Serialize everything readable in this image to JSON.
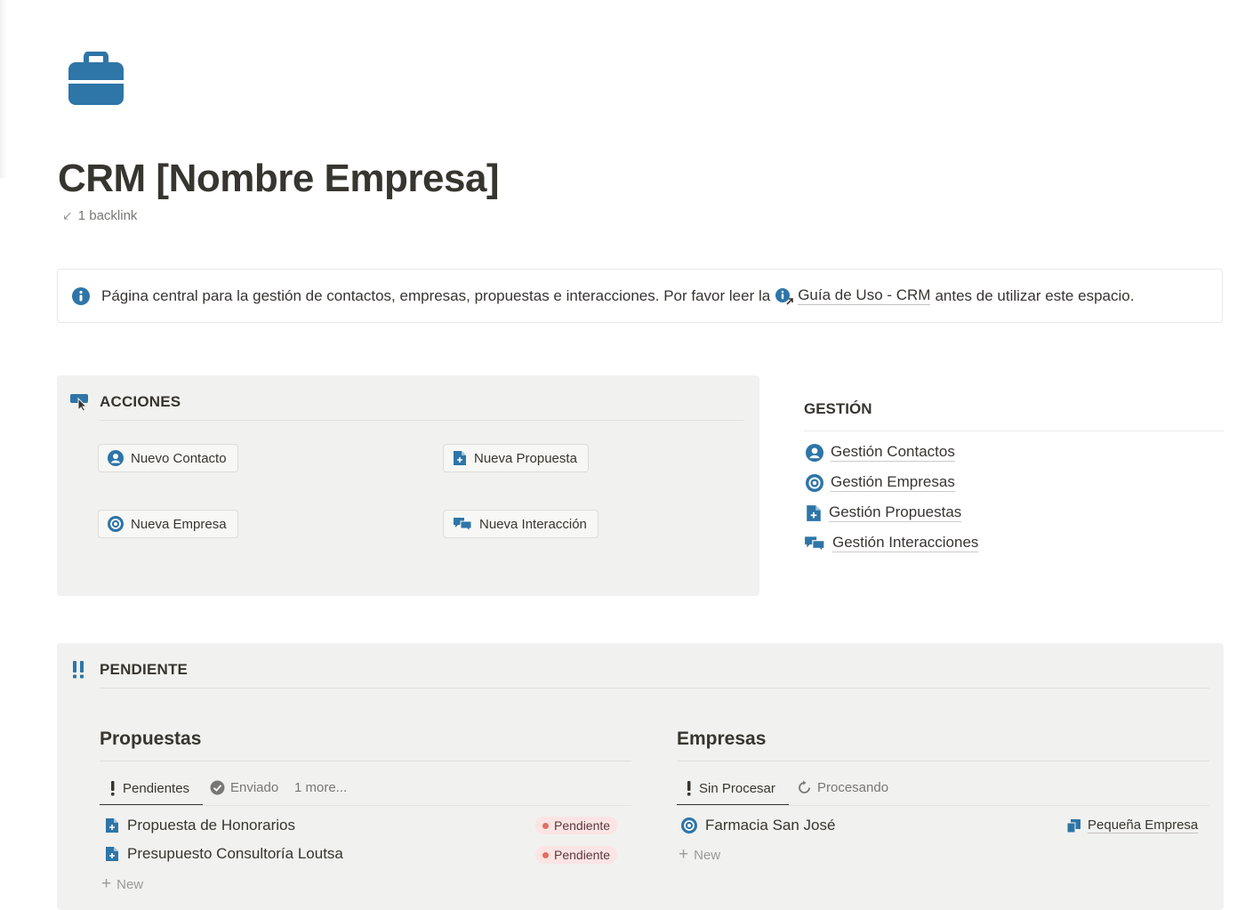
{
  "page": {
    "icon": "briefcase-icon",
    "title": "CRM [Nombre Empresa]",
    "backlink_text": "1 backlink"
  },
  "callout": {
    "icon": "info-icon",
    "text_before": "Página central para la gestión de contactos, empresas, propuestas e interacciones. Por favor leer la",
    "link_icon": "info-link-icon",
    "link_text": "Guía de Uso - CRM",
    "text_after": "antes de utilizar este espacio."
  },
  "acciones": {
    "heading": "ACCIONES",
    "icon": "pointer-icon",
    "buttons": [
      {
        "label": "Nuevo Contacto",
        "icon": "user-icon"
      },
      {
        "label": "Nueva Propuesta",
        "icon": "document-icon"
      },
      {
        "label": "Nueva Empresa",
        "icon": "target-icon"
      },
      {
        "label": "Nueva Interacción",
        "icon": "chat-icon"
      }
    ]
  },
  "gestion": {
    "heading": "GESTIÓN",
    "links": [
      {
        "label": "Gestión Contactos",
        "icon": "user-icon"
      },
      {
        "label": "Gestión Empresas",
        "icon": "target-icon"
      },
      {
        "label": "Gestión Propuestas",
        "icon": "document-icon"
      },
      {
        "label": "Gestión Interacciones",
        "icon": "chat-icon"
      }
    ]
  },
  "pendiente": {
    "heading": "PENDIENTE",
    "icon": "double-exclamation-icon",
    "propuestas": {
      "title": "Propuestas",
      "tabs": [
        {
          "label": "Pendientes",
          "icon": "exclamation-icon",
          "active": true
        },
        {
          "label": "Enviado",
          "icon": "check-circle-icon",
          "active": false
        },
        {
          "label": "1 more...",
          "icon": "",
          "active": false
        }
      ],
      "rows": [
        {
          "name": "Propuesta de Honorarios",
          "status": "Pendiente"
        },
        {
          "name": "Presupuesto Consultoría Loutsa",
          "status": "Pendiente"
        }
      ],
      "new_label": "New"
    },
    "empresas": {
      "title": "Empresas",
      "tabs": [
        {
          "label": "Sin Procesar",
          "icon": "exclamation-icon",
          "active": true
        },
        {
          "label": "Procesando",
          "icon": "refresh-icon",
          "active": false
        }
      ],
      "rows": [
        {
          "name": "Farmacia San José",
          "size": "Pequeña Empresa"
        }
      ],
      "new_label": "New"
    }
  },
  "colors": {
    "accent_blue": "#2e75a8",
    "status_red_bg": "#fbe4e4",
    "status_red_dot": "#e16f64",
    "block_bg": "#f1f1ef"
  }
}
